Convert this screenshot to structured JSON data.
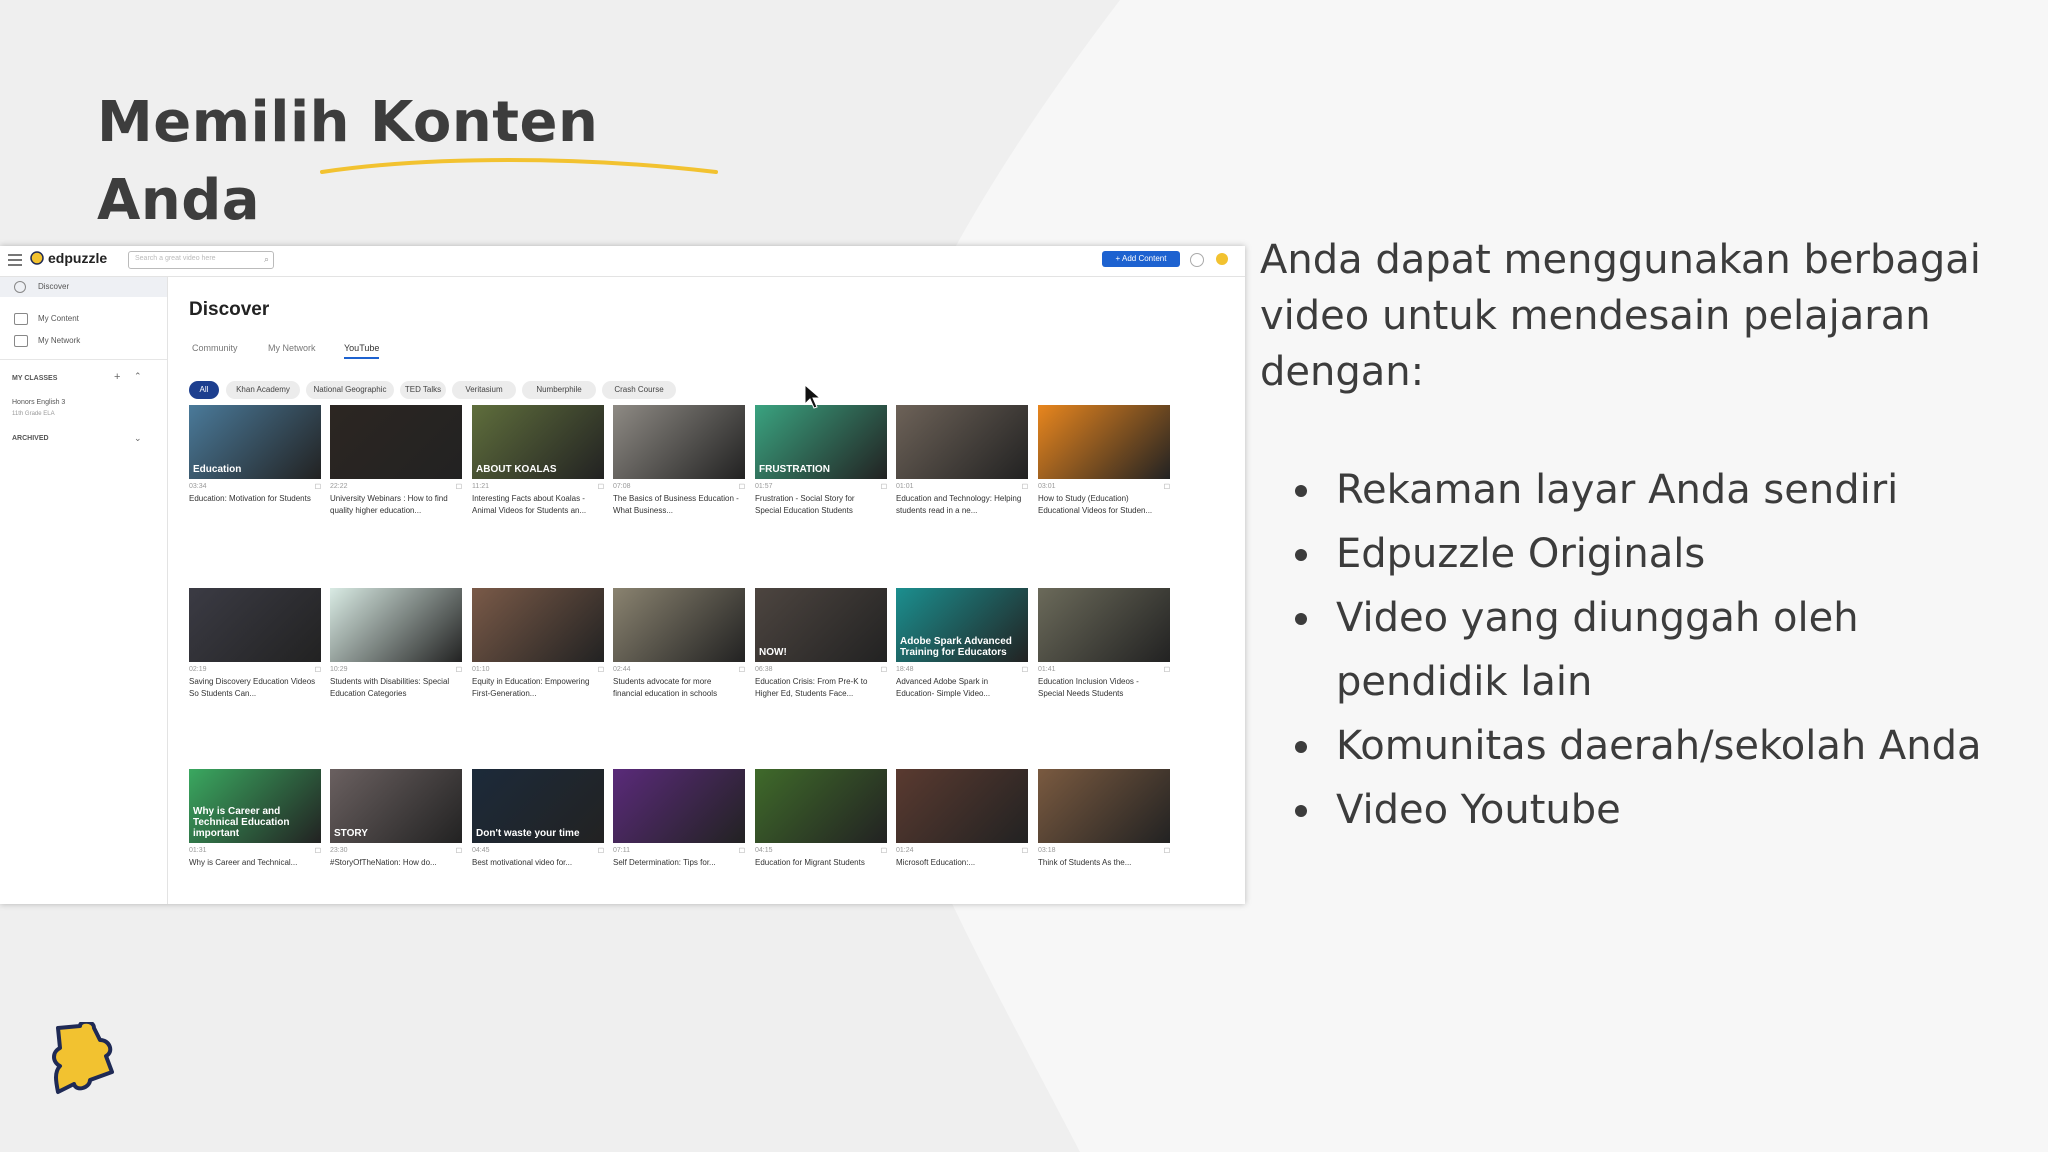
{
  "slide": {
    "title_line1": "Memilih Konten",
    "title_line2": "Anda",
    "intro": "Anda dapat menggunakan berbagai video untuk mendesain pelajaran dengan:",
    "bullets": [
      "Rekaman layar Anda sendiri",
      "Edpuzzle Originals",
      "Video yang diunggah oleh pendidik lain",
      "Komunitas daerah/sekolah Anda",
      "Video Youtube"
    ],
    "accent_color": "#f2c230",
    "logo_icon": "edpuzzle-puzzle-icon"
  },
  "app": {
    "brand": "edpuzzle",
    "search_placeholder": "Search a great video here",
    "add_content": "+ Add Content",
    "sidebar": {
      "discover": "Discover",
      "my_content": "My Content",
      "my_network": "My Network",
      "my_classes": "MY CLASSES",
      "class_name": "Honors English 3",
      "class_sub": "11th Grade ELA",
      "archived": "ARCHIVED"
    },
    "page_title": "Discover",
    "tabs": [
      "Community",
      "My Network",
      "YouTube"
    ],
    "chips": [
      "All",
      "Khan Academy",
      "National Geographic",
      "TED Talks",
      "Veritasium",
      "Numberphile",
      "Crash Course"
    ],
    "videos": [
      {
        "title": "Education: Motivation for Students",
        "duration": "03:34",
        "thumb_text": "Education",
        "color": "#4a7a9a"
      },
      {
        "title": "University Webinars : How to find quality higher education...",
        "duration": "22:22",
        "thumb_text": "",
        "color": "#2c2622"
      },
      {
        "title": "Interesting Facts about Koalas - Animal Videos for Students an...",
        "duration": "11:21",
        "thumb_text": "ABOUT KOALAS",
        "color": "#5f6e3c"
      },
      {
        "title": "The Basics of Business Education - What Business...",
        "duration": "07:08",
        "thumb_text": "",
        "color": "#8e8a84"
      },
      {
        "title": "Frustration - Social Story for Special Education Students",
        "duration": "01:57",
        "thumb_text": "FRUSTRATION",
        "color": "#3aa380"
      },
      {
        "title": "Education and Technology: Helping students read in a ne...",
        "duration": "01:01",
        "thumb_text": "",
        "color": "#6d6258"
      },
      {
        "title": "How to Study (Education) Educational Videos for Studen...",
        "duration": "03:01",
        "thumb_text": "",
        "color": "#e8861e"
      },
      {
        "title": "Saving Discovery Education Videos So Students Can...",
        "duration": "02:19",
        "thumb_text": "",
        "color": "#3b3b44"
      },
      {
        "title": "Students with Disabilities: Special Education Categories",
        "duration": "10:29",
        "thumb_text": "",
        "color": "#d9ebe4"
      },
      {
        "title": "Equity in Education: Empowering First-Generation...",
        "duration": "01:10",
        "thumb_text": "",
        "color": "#7a5a48"
      },
      {
        "title": "Students advocate for more financial education in schools",
        "duration": "02:44",
        "thumb_text": "",
        "color": "#8a8370"
      },
      {
        "title": "Education Crisis: From Pre-K to Higher Ed, Students Face...",
        "duration": "06:38",
        "thumb_text": "NOW!",
        "color": "#4d4540"
      },
      {
        "title": "Advanced Adobe Spark in Education- Simple Video...",
        "duration": "18:48",
        "thumb_text": "Adobe Spark Advanced Training for Educators",
        "color": "#1b8f8f"
      },
      {
        "title": "Education Inclusion Videos - Special Needs Students",
        "duration": "01:41",
        "thumb_text": "",
        "color": "#6b6a5a"
      },
      {
        "title": "Why is Career and Technical...",
        "duration": "01:31",
        "thumb_text": "Why is Career and Technical Education important",
        "color": "#3aa860"
      },
      {
        "title": "#StoryOfTheNation: How do...",
        "duration": "23:30",
        "thumb_text": "STORY",
        "color": "#6a6060"
      },
      {
        "title": "Best motivational video for...",
        "duration": "04:45",
        "thumb_text": "Don't waste your time",
        "color": "#1c2a3a"
      },
      {
        "title": "Self Determination: Tips for...",
        "duration": "07:11",
        "thumb_text": "",
        "color": "#5a2a7a"
      },
      {
        "title": "Education for Migrant Students",
        "duration": "04:15",
        "thumb_text": "",
        "color": "#3f6a2a"
      },
      {
        "title": "Microsoft Education:...",
        "duration": "01:24",
        "thumb_text": "",
        "color": "#5a3a30"
      },
      {
        "title": "Think of Students As the...",
        "duration": "03:18",
        "thumb_text": "",
        "color": "#7a5a40"
      }
    ]
  }
}
